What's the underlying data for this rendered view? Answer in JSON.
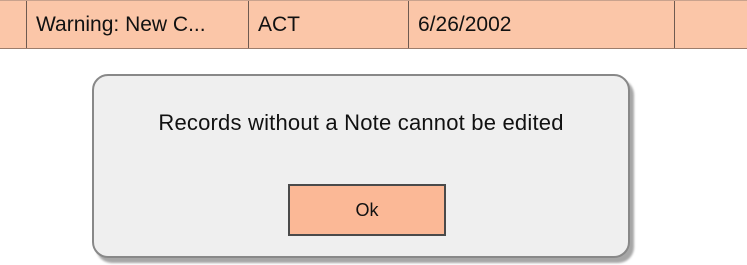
{
  "table_row": {
    "description": "Warning: New C...",
    "code": "ACT",
    "date": "6/26/2002",
    "extra": ""
  },
  "dialog": {
    "message": "Records without a Note cannot be edited",
    "ok_label": "Ok"
  },
  "colors": {
    "row_background": "#fbc6a8",
    "dialog_background": "#efefef",
    "button_background": "#fbb896"
  }
}
